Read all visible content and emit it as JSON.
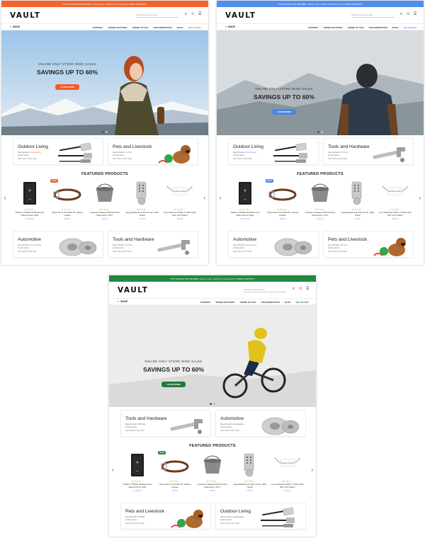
{
  "store": {
    "logo": "VAULT",
    "search_placeholder": "Search by name & code",
    "shop_label": "SHOP",
    "nav": [
      "SUPPORT",
      "THEME FEATURES",
      "THEME STYLES",
      "DOCUMENTATION",
      "BLOG"
    ],
    "nav_dropdown": "▾",
    "phone": "780 123-4567",
    "hero_sub": "ONLINE ONLY STORE WIDE SALES",
    "hero_title": "SAVINGS UP TO 60%",
    "hero_button": "LEARN MORE",
    "featured_title": "FEATURED PRODUCTS",
    "prev_arrow": "‹",
    "next_arrow": "›",
    "cart_count": "0"
  },
  "variants": [
    {
      "name": "orange",
      "accent": "#f5632a",
      "bar_color": "#f5632a",
      "button_color": "#ff5722",
      "badge": "#ff5722",
      "hero": "winter-woman",
      "banner": "TOP MARKETING BANNER  •  Enter code: VAULT at Checkout for FREE SHIPPING!"
    },
    {
      "name": "blue",
      "accent": "#4f8ef0",
      "bar_color": "#4f8ef0",
      "button_color": "#4b86e8",
      "badge": "#4b86e8",
      "hero": "mountain-hiker",
      "banner": "TOP MARKETING BANNER  •  Enter code: VAULT at Checkout for FREE SHIPPING!"
    },
    {
      "name": "green",
      "accent": "#1f7a3b",
      "bar_color": "#1f8a3e",
      "button_color": "#1f7a3b",
      "badge": "#1f8a3e",
      "hero": "mountain-biker",
      "banner": "TOP MARKETING BANNER  •  Enter code: VAULT at Checkout for FREE SHIPPING!"
    }
  ],
  "categories": {
    "outdoor": {
      "name": "Outdoor Living",
      "new": "New Arrivals in",
      "new_link": "Accessories",
      "tail": "at best prices",
      "link": "Save 40% off this week",
      "icon": "bbq-tools-icon"
    },
    "pets": {
      "name": "Pets and Livestock",
      "new": "New Arrivals in",
      "new_link": "All Pets",
      "tail": "at best prices",
      "link": "Save 40% off this week",
      "icon": "puppy-icon"
    },
    "tools": {
      "name": "Tools and Hardware",
      "new": "New Arrivals in",
      "new_link": "All Tools",
      "tail": "at best prices",
      "link": "Save 40% off this week",
      "icon": "wrench-icon"
    },
    "auto": {
      "name": "Automotive",
      "new": "New Arrivals in",
      "new_link": "Accessories",
      "tail": "at best prices",
      "link": "Save 40% off this week",
      "icon": "brake-disc-icon"
    }
  },
  "products": [
    {
      "name": "Safebox TS0604 45-Minute Fire Rated 40 Gun Safe",
      "stars": "★★★★☆",
      "price": "$1,299.00",
      "icon": "safe-icon"
    },
    {
      "name": "Calvin Men's Anvil Belt 32\" Classic Leather",
      "stars": "★★★★☆",
      "price": "$29.00",
      "icon": "belt-icon",
      "badge": "SALE"
    },
    {
      "name": "Cooking & Heating 596 Gas Rod, Galvanized, 10 Ft.",
      "stars": "★★★★☆",
      "price": "$45.00",
      "icon": "bucket-icon"
    },
    {
      "name": "Keypad Electronic Entry Knob, Satin Nickel",
      "stars": "★★★★☆",
      "price": "$79.00",
      "icon": "keypad-icon"
    },
    {
      "name": "Lucz Hardware W021-7T 820 Chain Bolt, Zinc Plated",
      "stars": "★★★★☆",
      "price": "$12.00",
      "icon": "chain-icon"
    }
  ],
  "chain_label": "Choose Options"
}
